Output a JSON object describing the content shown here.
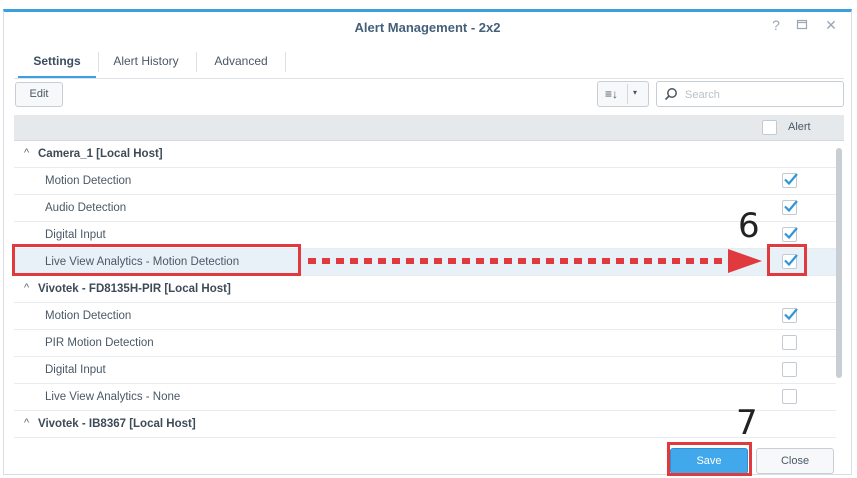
{
  "window": {
    "title": "Alert Management - 2x2"
  },
  "window_controls": [
    "help-icon",
    "maximize-icon",
    "close-icon"
  ],
  "tabs": [
    {
      "label": "Settings",
      "active": true
    },
    {
      "label": "Alert History",
      "active": false
    },
    {
      "label": "Advanced",
      "active": false
    }
  ],
  "toolbar": {
    "edit_label": "Edit",
    "sort_icon": "≡↓",
    "search_placeholder": "Search"
  },
  "table": {
    "header_alert": "Alert",
    "groups": [
      {
        "name": "Camera_1 [Local Host]",
        "items": [
          {
            "label": "Motion Detection",
            "checked": true
          },
          {
            "label": "Audio Detection",
            "checked": true
          },
          {
            "label": "Digital Input",
            "checked": true
          },
          {
            "label": "Live View Analytics - Motion Detection",
            "checked": true
          }
        ]
      },
      {
        "name": "Vivotek - FD8135H-PIR [Local Host]",
        "items": [
          {
            "label": "Motion Detection",
            "checked": true
          },
          {
            "label": "PIR Motion Detection",
            "checked": false
          },
          {
            "label": "Digital Input",
            "checked": false
          },
          {
            "label": "Live View Analytics - None",
            "checked": false
          }
        ]
      },
      {
        "name": "Vivotek - IB8367 [Local Host]",
        "items": []
      }
    ]
  },
  "footer": {
    "save_label": "Save",
    "close_label": "Close"
  },
  "annotations": {
    "step6": "6",
    "step7": "7"
  },
  "colors": {
    "accent": "#3aa0e0",
    "check": "#2f96d8",
    "annotation": "#e0393e",
    "save_bg": "#41a8ec"
  }
}
